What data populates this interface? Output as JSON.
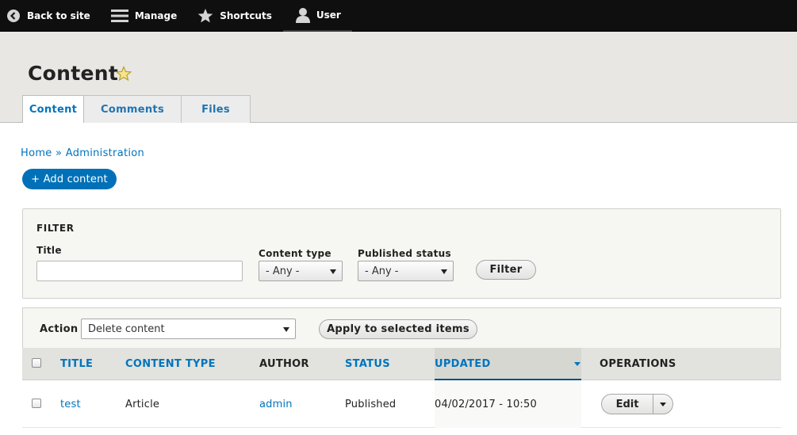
{
  "toolbar": {
    "back_label": "Back to site",
    "manage_label": "Manage",
    "shortcuts_label": "Shortcuts",
    "user_label": "User"
  },
  "header": {
    "title": "Content",
    "tabs": [
      {
        "label": "Content",
        "active": true
      },
      {
        "label": "Comments",
        "active": false
      },
      {
        "label": "Files",
        "active": false
      }
    ]
  },
  "breadcrumb": {
    "home": "Home",
    "separator": "»",
    "admin": "Administration"
  },
  "add_content_label": "+ Add content",
  "filter": {
    "legend": "FILTER",
    "title_label": "Title",
    "title_value": "",
    "content_type_label": "Content type",
    "content_type_value": "- Any -",
    "published_label": "Published status",
    "published_value": "- Any -",
    "filter_button": "Filter"
  },
  "bulk": {
    "action_label": "Action",
    "action_value": "Delete content",
    "apply_button": "Apply to selected items"
  },
  "table": {
    "columns": {
      "title": "TITLE",
      "content_type": "CONTENT TYPE",
      "author": "AUTHOR",
      "status": "STATUS",
      "updated": "UPDATED",
      "operations": "OPERATIONS"
    },
    "rows": [
      {
        "title": "test",
        "content_type": "Article",
        "author": "admin",
        "status": "Published",
        "updated": "04/02/2017 - 10:50",
        "edit_label": "Edit"
      }
    ]
  },
  "colors": {
    "toolbar_bg": "#0f0f0f",
    "header_bg": "#e8e7e3",
    "link": "#0074bd",
    "primary_button": "#0071b8",
    "star": "#f6e58d"
  }
}
